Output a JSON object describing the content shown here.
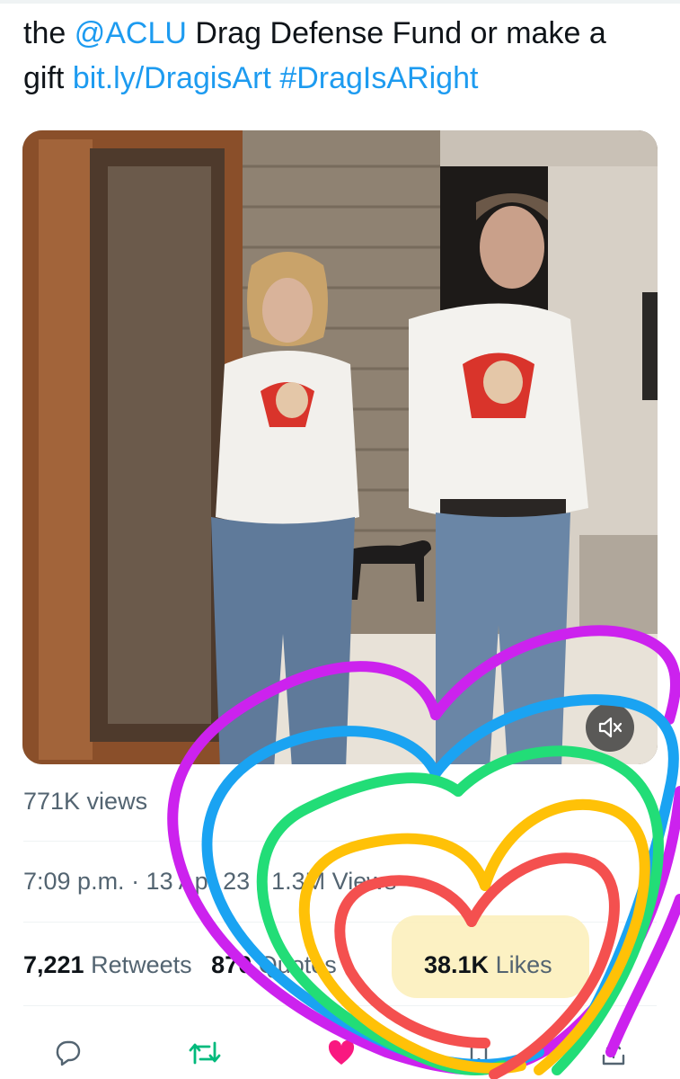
{
  "tweet": {
    "text_part1": "the ",
    "mention": "@ACLU",
    "text_part2": " Drag Defense Fund or make a gift ",
    "link": "bit.ly/DragisArt",
    "space": " ",
    "hashtag": "#DragIsARight"
  },
  "media": {
    "mute_icon": "speaker-muted-icon"
  },
  "views_line": {
    "label": "771K views"
  },
  "meta": {
    "text": "7:09 p.m. · 13 Apr 23 · 1.3M Views"
  },
  "engagement": {
    "retweets_count": "7,221",
    "retweets_label": "Retweets",
    "quotes_count": "870",
    "quotes_label": "Quotes",
    "likes_count": "38.1K",
    "likes_label": "Likes"
  },
  "actions": [
    {
      "icon": "reply-icon"
    },
    {
      "icon": "retweet-icon"
    },
    {
      "icon": "like-icon"
    },
    {
      "icon": "bookmark-icon"
    },
    {
      "icon": "share-icon"
    }
  ],
  "colors": {
    "link": "#1d9bf0",
    "retweet_green": "#00ba7c",
    "like_pink": "#f91880",
    "scribble_purple": "#cc22ee",
    "scribble_blue": "#1aa3f2",
    "scribble_green": "#22dd77",
    "scribble_yellow": "#ffc107",
    "scribble_red": "#f4504f"
  }
}
